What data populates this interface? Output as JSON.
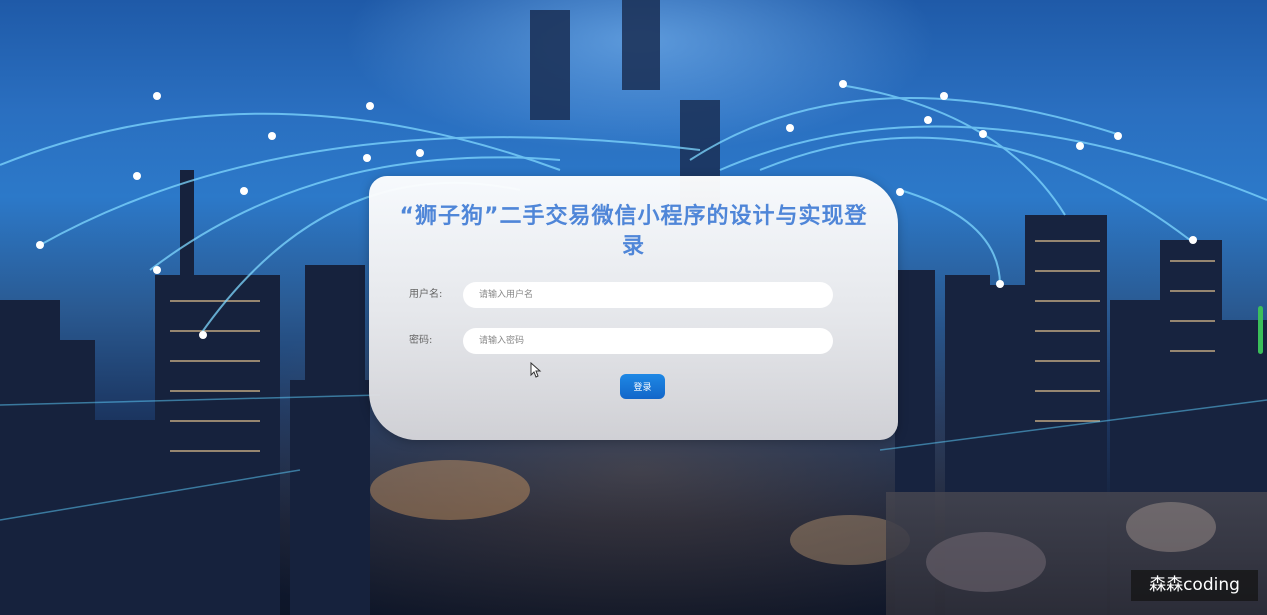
{
  "login": {
    "title": "“狮子狗”二手交易微信小程序的设计与实现登录",
    "username_label": "用户名:",
    "username_placeholder": "请输入用户名",
    "password_label": "密码:",
    "password_placeholder": "请输入密码",
    "login_button": "登录"
  },
  "watermark": "森森coding",
  "colors": {
    "title": "#4f86d8",
    "button": "#1e88e5",
    "scrollbar": "#3bbf5a"
  }
}
